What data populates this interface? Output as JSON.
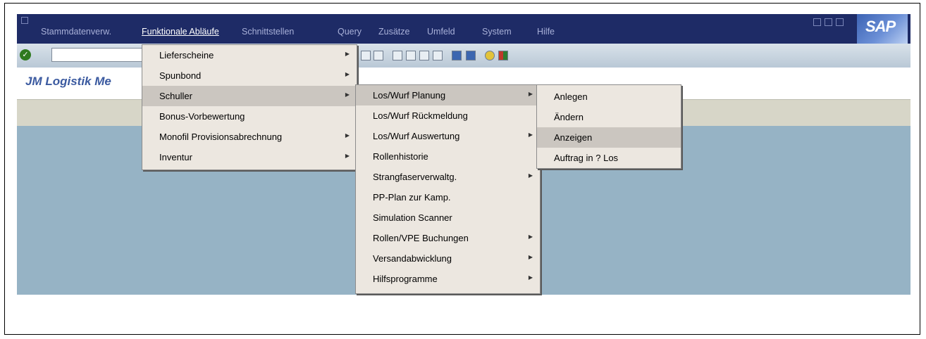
{
  "menubar": {
    "items": [
      {
        "label": "Stammdatenverw."
      },
      {
        "label": "Funktionale Abläufe"
      },
      {
        "label": "Schnittstellen"
      },
      {
        "label": "Query"
      },
      {
        "label": "Zusätze"
      },
      {
        "label": "Umfeld"
      },
      {
        "label": "System"
      },
      {
        "label": "Hilfe"
      }
    ],
    "logo": "SAP"
  },
  "toolbar": {
    "command_value": ""
  },
  "title": {
    "text": "JM Logistik Me"
  },
  "menu_functional": {
    "items": [
      {
        "label": "Lieferscheine",
        "submenu": true
      },
      {
        "label": "Spunbond",
        "submenu": true
      },
      {
        "label": "Schuller",
        "submenu": true,
        "highlighted": true
      },
      {
        "label": "Bonus-Vorbewertung",
        "submenu": false
      },
      {
        "label": "Monofil Provisionsabrechnung",
        "submenu": true
      },
      {
        "label": "Inventur",
        "submenu": true
      }
    ]
  },
  "menu_schuller": {
    "items": [
      {
        "label": "Los/Wurf Planung",
        "submenu": true,
        "highlighted": true
      },
      {
        "label": "Los/Wurf Rückmeldung",
        "submenu": false
      },
      {
        "label": "Los/Wurf Auswertung",
        "submenu": true
      },
      {
        "label": "Rollenhistorie",
        "submenu": false
      },
      {
        "label": "Strangfaserverwaltg.",
        "submenu": true
      },
      {
        "label": "PP-Plan zur Kamp.",
        "submenu": false
      },
      {
        "label": "Simulation Scanner",
        "submenu": false
      },
      {
        "label": "Rollen/VPE Buchungen",
        "submenu": true
      },
      {
        "label": "Versandabwicklung",
        "submenu": true
      },
      {
        "label": "Hilfsprogramme",
        "submenu": true
      }
    ]
  },
  "menu_planung": {
    "items": [
      {
        "label": "Anlegen"
      },
      {
        "label": "Ändern"
      },
      {
        "label": "Anzeigen",
        "highlighted": true
      },
      {
        "label": "Auftrag in ? Los"
      }
    ]
  },
  "icons": {
    "enter": "check-icon",
    "help": "help-icon",
    "layout": "layout-menu-icon"
  },
  "colors": {
    "menubar_bg": "#1e2b66",
    "menu_bg": "#ece7e0",
    "highlight_bg": "#cbc6c0",
    "workarea_bg": "#96b3c5",
    "title_color": "#3b5aa0"
  }
}
